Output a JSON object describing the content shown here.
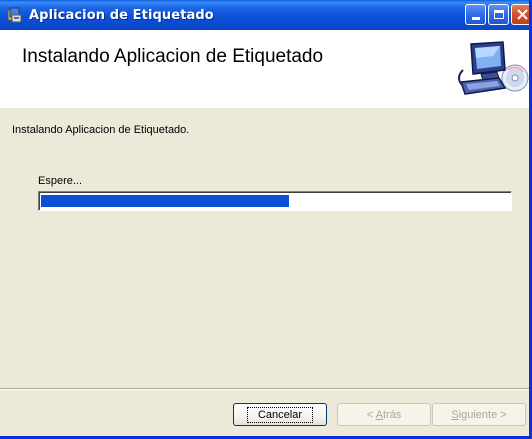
{
  "window": {
    "title": "Aplicacion de Etiquetado"
  },
  "header": {
    "title": "Instalando Aplicacion de Etiquetado",
    "image": "computer-setup-icon"
  },
  "body": {
    "status_text": "Instalando Aplicacion de Etiquetado.",
    "wait_label": "Espere...",
    "progress_fraction": 0.53
  },
  "buttons": {
    "cancel_label": "Cancelar",
    "back_label_prefix": "< ",
    "back_label_accel": "A",
    "back_label_rest": "trás",
    "next_label_accel": "S",
    "next_label_rest": "iguiente >"
  },
  "colors": {
    "title_bar": "#0b52d8",
    "progress_fill": "#0a4fd6",
    "close_button": "#d2512d"
  }
}
